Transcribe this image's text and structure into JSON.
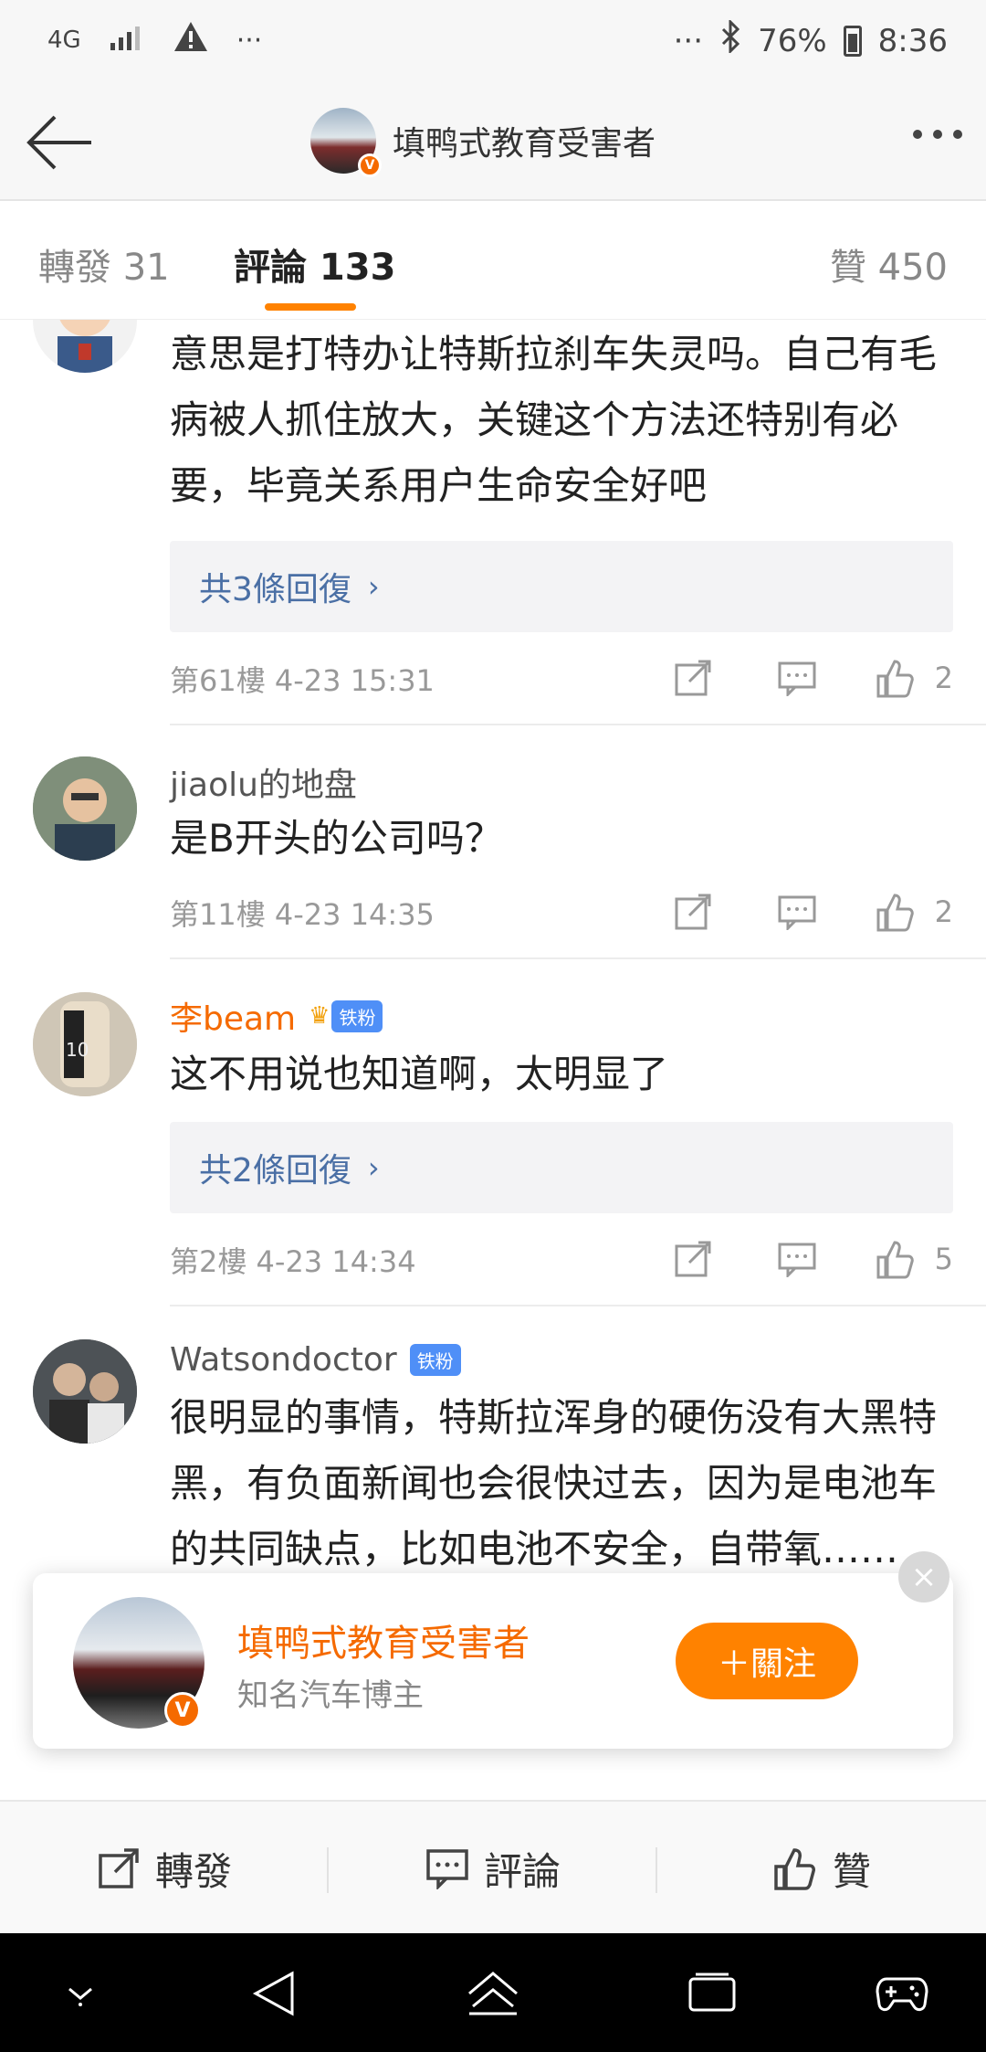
{
  "status_bar": {
    "network": "4G",
    "dots_left": "···",
    "dots_right": "···",
    "battery": "76%",
    "time": "8:36"
  },
  "header": {
    "title": "填鸭式教育受害者",
    "verified_badge": "V"
  },
  "tabs": {
    "repost": "轉發 31",
    "comments": "評論 133",
    "likes": "贊 450"
  },
  "comments": [
    {
      "text": "意思是打特办让特斯拉刹车失灵吗。自己有毛病被人抓住放大，关键这个方法还特别有必要，毕竟关系用户生命安全好吧",
      "replies": "共3條回復",
      "meta": "第61樓  4-23 15:31",
      "likes": "2"
    },
    {
      "name": "jiaolu的地盘",
      "text": "是B开头的公司吗？",
      "meta": "第11樓  4-23 14:35",
      "likes": "2"
    },
    {
      "name": "李beam",
      "badge": "铁粉",
      "text": "这不用说也知道啊，太明显了",
      "replies": "共2條回復",
      "meta": "第2樓  4-23 14:34",
      "likes": "5"
    },
    {
      "name": "Watsondoctor",
      "badge": "铁粉",
      "text": "很明显的事情，特斯拉浑身的硬伤没有大黑特黑，有负面新闻也会很快过去，因为是电池车的共同缺点，比如电池不安全，自带氧……大，内饰粗……大屏的……速巡航……动驾驶等等。这次热点就往死里黑，明显的同行发"
    }
  ],
  "follow_card": {
    "name": "填鸭式教育受害者",
    "subtitle": "知名汽车博主",
    "follow_label": "＋關注",
    "close": "×"
  },
  "bottom_bar": {
    "repost": "轉發",
    "comment": "評論",
    "like": "贊"
  },
  "colors": {
    "accent": "#ff8200",
    "link": "#4a6fa5",
    "fan_badge": "#4f8ff7"
  }
}
